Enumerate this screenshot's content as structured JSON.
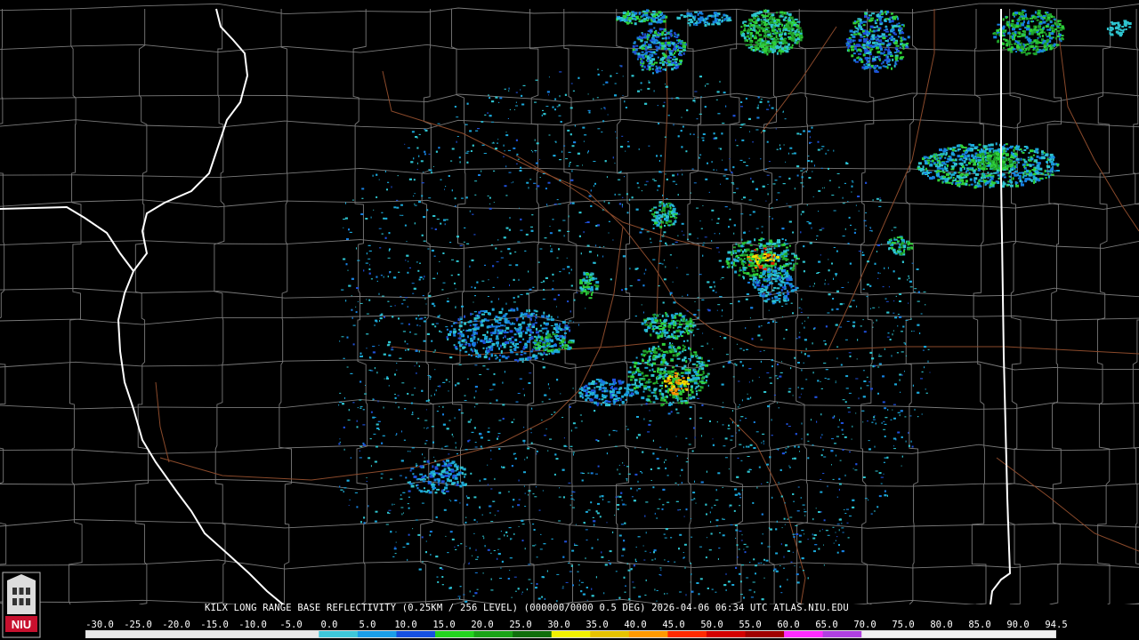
{
  "product": {
    "caption": "KILX LONG RANGE BASE REFLECTIVITY (0.25KM / 256 LEVEL) (000000/0000 0.5 DEG) 2026-04-06 06:34 UTC  ATLAS.NIU.EDU",
    "logo_text": "NIU"
  },
  "legend": {
    "labels": [
      "-30.0",
      "-25.0",
      "-20.0",
      "-15.0",
      "-10.0",
      "-5.0",
      "0.0",
      "5.0",
      "10.0",
      "15.0",
      "20.0",
      "25.0",
      "30.0",
      "35.0",
      "40.0",
      "45.0",
      "50.0",
      "55.0",
      "60.0",
      "65.0",
      "70.0",
      "75.0",
      "80.0",
      "85.0",
      "90.0",
      "94.5"
    ],
    "colors": [
      "#ffffff",
      "#ffffff",
      "#ffffff",
      "#ffffff",
      "#ffffff",
      "#ffffff",
      "#40e0d0",
      "#1e90ff",
      "#0000e0",
      "#00d000",
      "#009000",
      "#005f00",
      "#ffff00",
      "#e6b800",
      "#ff8c00",
      "#ff0000",
      "#c00000",
      "#900000",
      "#ff00ff",
      "#9932cc",
      "#ffffff",
      "#ffffff",
      "#ffffff",
      "#ffffff",
      "#ffffff"
    ],
    "cell_colors": [
      "#e8e8e8",
      "#e8e8e8",
      "#e8e8e8",
      "#e8e8e8",
      "#e8e8e8",
      "#e8e8e8",
      "#3ec7d9",
      "#1a9ee8",
      "#1550e0",
      "#23d41e",
      "#19a316",
      "#0f6e0c",
      "#f0f000",
      "#e6c200",
      "#ff9900",
      "#ff2a00",
      "#d40000",
      "#a00000",
      "#ff2cff",
      "#b040e0",
      "#f0f0f0",
      "#f0f0f0",
      "#f0f0f0",
      "#f0f0f0",
      "#f0f0f0"
    ]
  },
  "map": {
    "radar_site": "KILX",
    "state_border_color": "#ffffff",
    "county_line_color": "#8a8a8a",
    "road_color": "#8b4a2b"
  }
}
